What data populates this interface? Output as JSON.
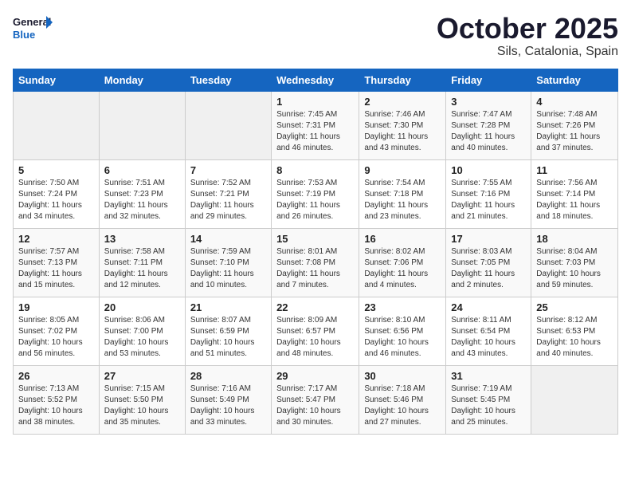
{
  "header": {
    "logo_general": "General",
    "logo_blue": "Blue",
    "month": "October 2025",
    "location": "Sils, Catalonia, Spain"
  },
  "days_of_week": [
    "Sunday",
    "Monday",
    "Tuesday",
    "Wednesday",
    "Thursday",
    "Friday",
    "Saturday"
  ],
  "weeks": [
    [
      {
        "num": "",
        "info": ""
      },
      {
        "num": "",
        "info": ""
      },
      {
        "num": "",
        "info": ""
      },
      {
        "num": "1",
        "info": "Sunrise: 7:45 AM\nSunset: 7:31 PM\nDaylight: 11 hours and 46 minutes."
      },
      {
        "num": "2",
        "info": "Sunrise: 7:46 AM\nSunset: 7:30 PM\nDaylight: 11 hours and 43 minutes."
      },
      {
        "num": "3",
        "info": "Sunrise: 7:47 AM\nSunset: 7:28 PM\nDaylight: 11 hours and 40 minutes."
      },
      {
        "num": "4",
        "info": "Sunrise: 7:48 AM\nSunset: 7:26 PM\nDaylight: 11 hours and 37 minutes."
      }
    ],
    [
      {
        "num": "5",
        "info": "Sunrise: 7:50 AM\nSunset: 7:24 PM\nDaylight: 11 hours and 34 minutes."
      },
      {
        "num": "6",
        "info": "Sunrise: 7:51 AM\nSunset: 7:23 PM\nDaylight: 11 hours and 32 minutes."
      },
      {
        "num": "7",
        "info": "Sunrise: 7:52 AM\nSunset: 7:21 PM\nDaylight: 11 hours and 29 minutes."
      },
      {
        "num": "8",
        "info": "Sunrise: 7:53 AM\nSunset: 7:19 PM\nDaylight: 11 hours and 26 minutes."
      },
      {
        "num": "9",
        "info": "Sunrise: 7:54 AM\nSunset: 7:18 PM\nDaylight: 11 hours and 23 minutes."
      },
      {
        "num": "10",
        "info": "Sunrise: 7:55 AM\nSunset: 7:16 PM\nDaylight: 11 hours and 21 minutes."
      },
      {
        "num": "11",
        "info": "Sunrise: 7:56 AM\nSunset: 7:14 PM\nDaylight: 11 hours and 18 minutes."
      }
    ],
    [
      {
        "num": "12",
        "info": "Sunrise: 7:57 AM\nSunset: 7:13 PM\nDaylight: 11 hours and 15 minutes."
      },
      {
        "num": "13",
        "info": "Sunrise: 7:58 AM\nSunset: 7:11 PM\nDaylight: 11 hours and 12 minutes."
      },
      {
        "num": "14",
        "info": "Sunrise: 7:59 AM\nSunset: 7:10 PM\nDaylight: 11 hours and 10 minutes."
      },
      {
        "num": "15",
        "info": "Sunrise: 8:01 AM\nSunset: 7:08 PM\nDaylight: 11 hours and 7 minutes."
      },
      {
        "num": "16",
        "info": "Sunrise: 8:02 AM\nSunset: 7:06 PM\nDaylight: 11 hours and 4 minutes."
      },
      {
        "num": "17",
        "info": "Sunrise: 8:03 AM\nSunset: 7:05 PM\nDaylight: 11 hours and 2 minutes."
      },
      {
        "num": "18",
        "info": "Sunrise: 8:04 AM\nSunset: 7:03 PM\nDaylight: 10 hours and 59 minutes."
      }
    ],
    [
      {
        "num": "19",
        "info": "Sunrise: 8:05 AM\nSunset: 7:02 PM\nDaylight: 10 hours and 56 minutes."
      },
      {
        "num": "20",
        "info": "Sunrise: 8:06 AM\nSunset: 7:00 PM\nDaylight: 10 hours and 53 minutes."
      },
      {
        "num": "21",
        "info": "Sunrise: 8:07 AM\nSunset: 6:59 PM\nDaylight: 10 hours and 51 minutes."
      },
      {
        "num": "22",
        "info": "Sunrise: 8:09 AM\nSunset: 6:57 PM\nDaylight: 10 hours and 48 minutes."
      },
      {
        "num": "23",
        "info": "Sunrise: 8:10 AM\nSunset: 6:56 PM\nDaylight: 10 hours and 46 minutes."
      },
      {
        "num": "24",
        "info": "Sunrise: 8:11 AM\nSunset: 6:54 PM\nDaylight: 10 hours and 43 minutes."
      },
      {
        "num": "25",
        "info": "Sunrise: 8:12 AM\nSunset: 6:53 PM\nDaylight: 10 hours and 40 minutes."
      }
    ],
    [
      {
        "num": "26",
        "info": "Sunrise: 7:13 AM\nSunset: 5:52 PM\nDaylight: 10 hours and 38 minutes."
      },
      {
        "num": "27",
        "info": "Sunrise: 7:15 AM\nSunset: 5:50 PM\nDaylight: 10 hours and 35 minutes."
      },
      {
        "num": "28",
        "info": "Sunrise: 7:16 AM\nSunset: 5:49 PM\nDaylight: 10 hours and 33 minutes."
      },
      {
        "num": "29",
        "info": "Sunrise: 7:17 AM\nSunset: 5:47 PM\nDaylight: 10 hours and 30 minutes."
      },
      {
        "num": "30",
        "info": "Sunrise: 7:18 AM\nSunset: 5:46 PM\nDaylight: 10 hours and 27 minutes."
      },
      {
        "num": "31",
        "info": "Sunrise: 7:19 AM\nSunset: 5:45 PM\nDaylight: 10 hours and 25 minutes."
      },
      {
        "num": "",
        "info": ""
      }
    ]
  ]
}
